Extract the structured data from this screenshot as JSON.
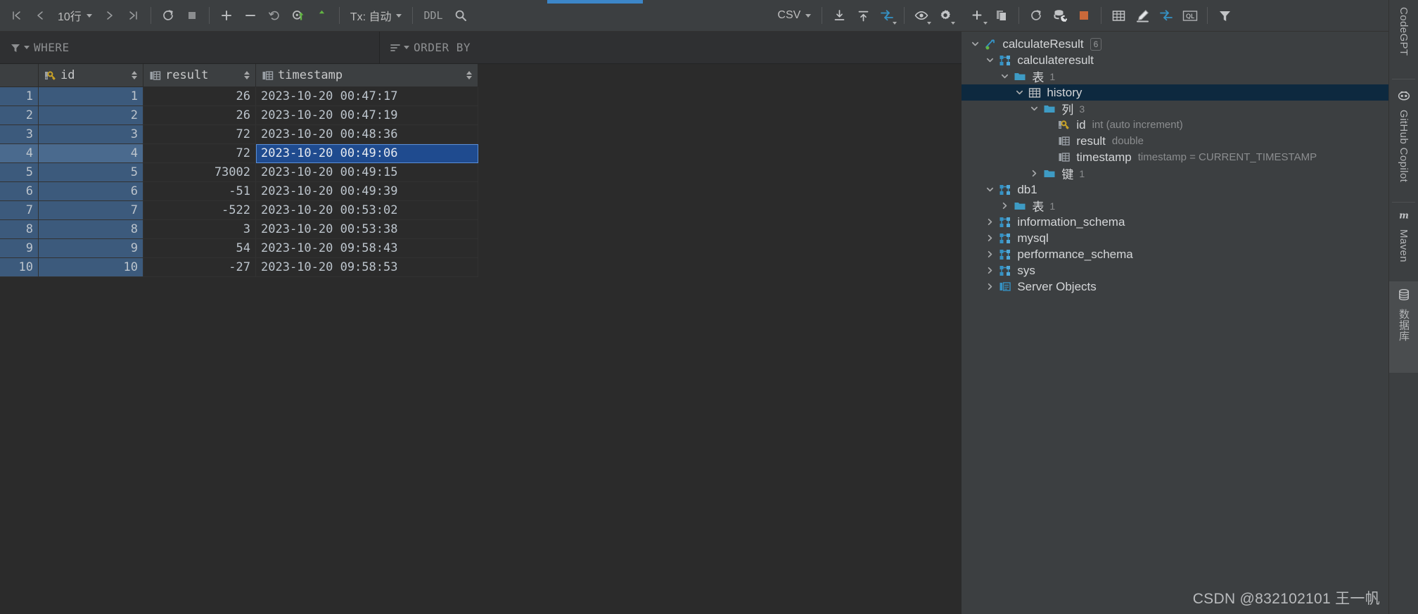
{
  "grid_toolbar": {
    "first_page_icon": "first-page-icon",
    "prev_page_icon": "prev-page-icon",
    "page_size_label": "10行",
    "next_page_icon": "next-page-icon",
    "last_page_icon": "last-page-icon",
    "refresh_icon": "refresh-icon",
    "stop_icon": "stop-icon",
    "add_row_icon": "add-row-icon",
    "delete_row_icon": "delete-row-icon",
    "revert_icon": "revert-icon",
    "commit_icon": "commit-icon",
    "submit_icon": "submit-upload-icon",
    "tx_label": "Tx: 自动",
    "ddl_label": "DDL",
    "search_icon": "search-icon",
    "format_label": "CSV",
    "export_icon": "export-download-icon",
    "import_icon": "import-upload-icon",
    "data_extractor_icon": "data-transfer-icon",
    "view_options_icon": "eye-view-icon",
    "settings_icon": "gear-icon"
  },
  "filter_bar": {
    "where_icon": "filter-funnel-icon",
    "where_label": "WHERE",
    "order_icon": "sort-lines-icon",
    "order_label": "ORDER BY"
  },
  "grid": {
    "columns": [
      {
        "key": "rownum",
        "label": "",
        "icon": "",
        "sortable": false
      },
      {
        "key": "id",
        "label": "id",
        "icon": "primary-key-icon",
        "sortable": true
      },
      {
        "key": "result",
        "label": "result",
        "icon": "column-icon",
        "sortable": true
      },
      {
        "key": "timestamp",
        "label": "timestamp",
        "icon": "column-icon",
        "sortable": true
      }
    ],
    "selected_column": "id",
    "focused_row": 4,
    "selected_cell": {
      "row": 4,
      "column": "timestamp"
    },
    "rows": [
      {
        "rownum": "1",
        "id": "1",
        "result": "26",
        "timestamp": "2023-10-20 00:47:17"
      },
      {
        "rownum": "2",
        "id": "2",
        "result": "26",
        "timestamp": "2023-10-20 00:47:19"
      },
      {
        "rownum": "3",
        "id": "3",
        "result": "72",
        "timestamp": "2023-10-20 00:48:36"
      },
      {
        "rownum": "4",
        "id": "4",
        "result": "72",
        "timestamp": "2023-10-20 00:49:06"
      },
      {
        "rownum": "5",
        "id": "5",
        "result": "73002",
        "timestamp": "2023-10-20 00:49:15"
      },
      {
        "rownum": "6",
        "id": "6",
        "result": "-51",
        "timestamp": "2023-10-20 00:49:39"
      },
      {
        "rownum": "7",
        "id": "7",
        "result": "-522",
        "timestamp": "2023-10-20 00:53:02"
      },
      {
        "rownum": "8",
        "id": "8",
        "result": "3",
        "timestamp": "2023-10-20 00:53:38"
      },
      {
        "rownum": "9",
        "id": "9",
        "result": "54",
        "timestamp": "2023-10-20 09:58:43"
      },
      {
        "rownum": "10",
        "id": "10",
        "result": "-27",
        "timestamp": "2023-10-20 09:58:53"
      }
    ]
  },
  "tree_toolbar": {
    "add_icon": "plus-add-icon",
    "duplicate_icon": "copy-duplicate-icon",
    "refresh_icon": "refresh-icon",
    "db_tools_icon": "database-wrench-icon",
    "stop_icon": "stop-square-icon",
    "table_editor_icon": "table-grid-icon",
    "modify_icon": "pencil-edit-icon",
    "transfer_icon": "data-transfer-icon",
    "query_console_icon": "ql-console-icon",
    "filter_icon": "filter-funnel-icon"
  },
  "tree": {
    "nodes": [
      {
        "indent": 0,
        "twist": "down",
        "icon": "datasource-icon",
        "label": "calculateResult",
        "badge": "6",
        "sub": "",
        "selected": false
      },
      {
        "indent": 1,
        "twist": "down",
        "icon": "schema-icon",
        "label": "calculateresult",
        "badge": "",
        "sub": "",
        "selected": false
      },
      {
        "indent": 2,
        "twist": "down",
        "icon": "folder-icon",
        "label": "表",
        "count": "1",
        "sub": "",
        "selected": false
      },
      {
        "indent": 3,
        "twist": "down",
        "icon": "table-icon",
        "label": "history",
        "badge": "",
        "sub": "",
        "selected": true
      },
      {
        "indent": 4,
        "twist": "down",
        "icon": "folder-icon",
        "label": "列",
        "count": "3",
        "sub": "",
        "selected": false
      },
      {
        "indent": 5,
        "twist": "none",
        "icon": "primary-key-icon",
        "label": "id",
        "badge": "",
        "sub": "int (auto increment)",
        "selected": false
      },
      {
        "indent": 5,
        "twist": "none",
        "icon": "column-icon",
        "label": "result",
        "badge": "",
        "sub": "double",
        "selected": false
      },
      {
        "indent": 5,
        "twist": "none",
        "icon": "column-icon",
        "label": "timestamp",
        "badge": "",
        "sub": "timestamp = CURRENT_TIMESTAMP",
        "selected": false
      },
      {
        "indent": 4,
        "twist": "right",
        "icon": "folder-icon",
        "label": "键",
        "count": "1",
        "sub": "",
        "selected": false
      },
      {
        "indent": 1,
        "twist": "down",
        "icon": "schema-icon",
        "label": "db1",
        "badge": "",
        "sub": "",
        "selected": false
      },
      {
        "indent": 2,
        "twist": "right",
        "icon": "folder-icon",
        "label": "表",
        "count": "1",
        "sub": "",
        "selected": false
      },
      {
        "indent": 1,
        "twist": "right",
        "icon": "schema-icon",
        "label": "information_schema",
        "badge": "",
        "sub": "",
        "selected": false
      },
      {
        "indent": 1,
        "twist": "right",
        "icon": "schema-icon",
        "label": "mysql",
        "badge": "",
        "sub": "",
        "selected": false
      },
      {
        "indent": 1,
        "twist": "right",
        "icon": "schema-icon",
        "label": "performance_schema",
        "badge": "",
        "sub": "",
        "selected": false
      },
      {
        "indent": 1,
        "twist": "right",
        "icon": "schema-icon",
        "label": "sys",
        "badge": "",
        "sub": "",
        "selected": false
      },
      {
        "indent": 1,
        "twist": "right",
        "icon": "server-objects-icon",
        "label": "Server Objects",
        "badge": "",
        "sub": "",
        "selected": false
      }
    ]
  },
  "tool_window_strip": {
    "items": [
      {
        "label": "CodeGPT",
        "icon": "codegpt-icon",
        "active": false
      },
      {
        "label": "GitHub Copilot",
        "icon": "github-copilot-icon",
        "active": false
      },
      {
        "label": "Maven",
        "icon": "maven-icon",
        "active": false
      },
      {
        "label": "数据库",
        "icon": "database-icon",
        "active": true
      }
    ]
  },
  "watermark": {
    "text": "CSDN @832102101 王一帆"
  },
  "colors": {
    "accent_blue": "#3c86c8",
    "selection_blue": "#1f4b8f",
    "column_selection": "#3c5a7c",
    "tree_selection": "#0d293f",
    "toolbar_bg": "#3c3f41",
    "grid_bg": "#2b2b2b",
    "key_gold": "#c9a227",
    "icon_blue": "#3592c4",
    "stop_orange": "#c9693a",
    "commit_green": "#62b543"
  }
}
